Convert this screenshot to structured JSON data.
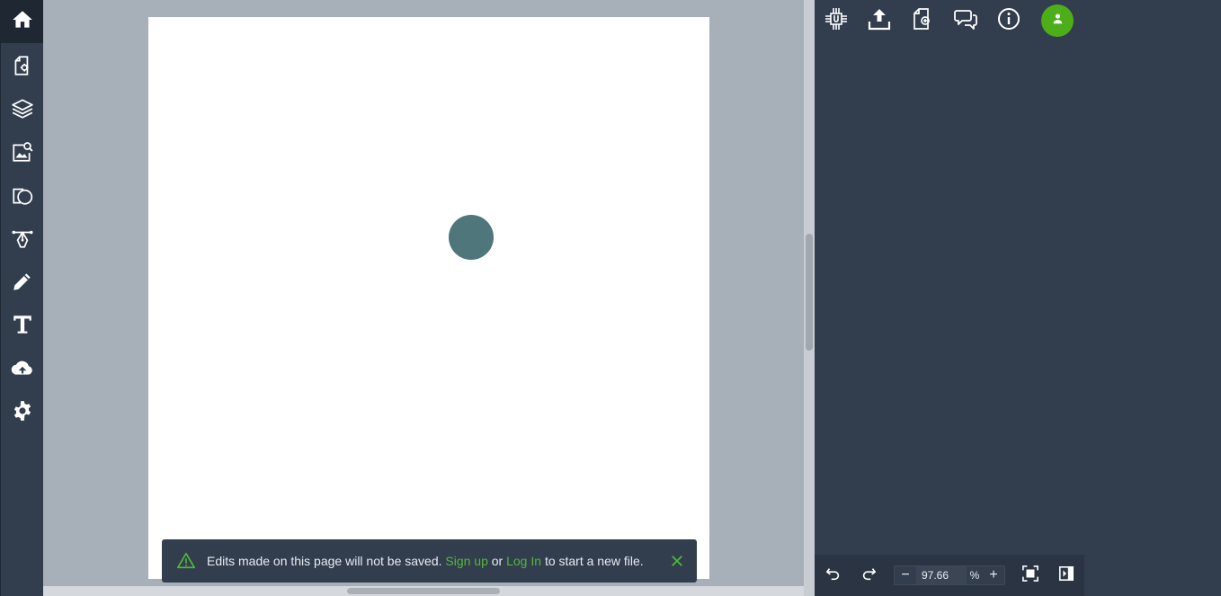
{
  "left_toolbar": {
    "items": [
      {
        "icon": "home-icon"
      },
      {
        "icon": "page-settings-icon"
      },
      {
        "icon": "layers-icon"
      },
      {
        "icon": "image-search-icon"
      },
      {
        "icon": "shapes-icon"
      },
      {
        "icon": "pen-tool-icon"
      },
      {
        "icon": "pencil-icon"
      },
      {
        "icon": "text-icon"
      },
      {
        "icon": "cloud-upload-icon"
      },
      {
        "icon": "gear-icon"
      }
    ]
  },
  "canvas": {
    "background": "#a7afb9",
    "artboard_color": "#ffffff",
    "circle_color": "#4f767b"
  },
  "toast": {
    "message": "Edits made on this page will not be saved.",
    "signup_label": "Sign up",
    "or_text": "or",
    "login_label": "Log In",
    "suffix": "to start a new file.",
    "link_color": "#52b83a"
  },
  "right_panel": {
    "top_icons": [
      "plugins-icon",
      "export-icon",
      "new-file-icon",
      "comments-icon",
      "info-icon",
      "user-avatar-icon"
    ],
    "avatar_color": "#4caf1a"
  },
  "bottom_bar": {
    "zoom_value": "97.66",
    "zoom_unit": "%",
    "minus_label": "−",
    "plus_label": "+"
  },
  "colors": {
    "panel_bg": "#323e4e",
    "icon": "#ffffff"
  }
}
